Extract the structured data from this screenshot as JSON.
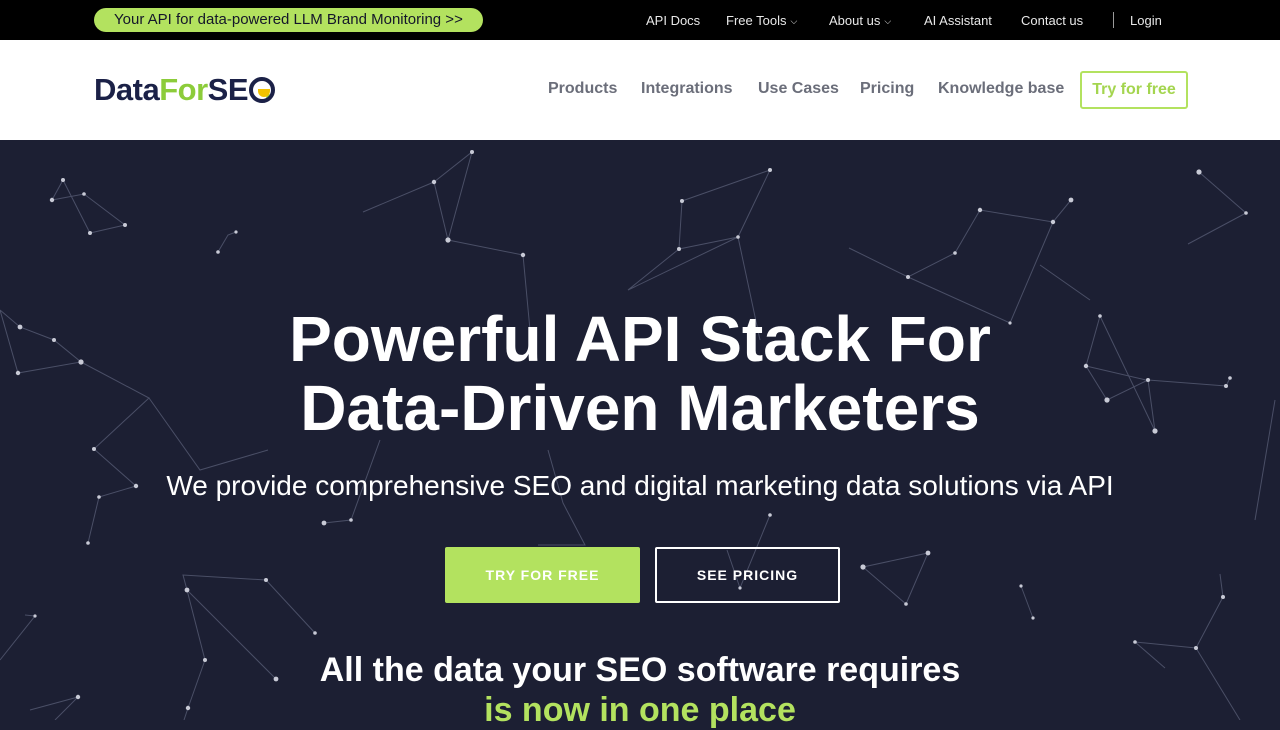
{
  "topbar": {
    "promo": "Your API for data-powered LLM Brand Monitoring >>",
    "links": {
      "api_docs": "API Docs",
      "free_tools": "Free Tools",
      "about_us": "About us",
      "ai_assistant": "AI Assistant",
      "contact_us": "Contact us",
      "login": "Login"
    },
    "chevron": "⌄"
  },
  "header": {
    "logo": {
      "part1": "Data",
      "part2": "For",
      "part3": "SE"
    },
    "nav": {
      "products": "Products",
      "integrations": "Integrations",
      "use_cases": "Use Cases",
      "pricing": "Pricing",
      "knowledge_base": "Knowledge base"
    },
    "cta": "Try for free"
  },
  "hero": {
    "title_line1": "Powerful API Stack For",
    "title_line2": "Data-Driven Marketers",
    "subtitle": "We provide comprehensive SEO and digital marketing data solutions via API",
    "primary_button": "TRY FOR FREE",
    "secondary_button": "SEE PRICING",
    "tagline_line1": "All the data your SEO software requires",
    "tagline_line2": "is now in one place"
  },
  "colors": {
    "accent_green": "#b3e25f",
    "hero_bg": "#1c1f33",
    "logo_navy": "#1b2147",
    "logo_yellow": "#f2c200"
  }
}
